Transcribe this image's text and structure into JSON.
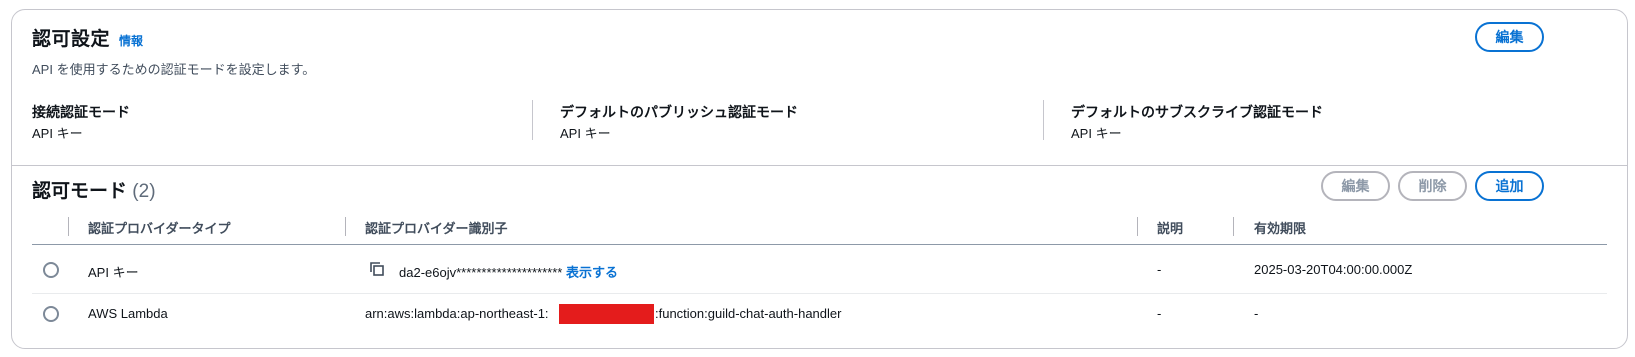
{
  "auth_settings": {
    "title": "認可設定",
    "info_link": "情報",
    "description": "API を使用するための認証モードを設定します。",
    "edit_button": "編集",
    "fields": [
      {
        "label": "接続認証モード",
        "value": "API キー"
      },
      {
        "label": "デフォルトのパブリッシュ認証モード",
        "value": "API キー"
      },
      {
        "label": "デフォルトのサブスクライブ認証モード",
        "value": "API キー"
      }
    ]
  },
  "auth_modes": {
    "title": "認可モード",
    "count": "(2)",
    "buttons": {
      "edit": "編集",
      "delete": "削除",
      "add": "追加"
    },
    "columns": [
      "認証プロバイダータイプ",
      "認証プロバイダー識別子",
      "説明",
      "有効期限"
    ],
    "rows": [
      {
        "type": "API キー",
        "identifier": "da2-e6ojv*********************",
        "show_link": "表示する",
        "description": "-",
        "expiry": "2025-03-20T04:00:00.000Z"
      },
      {
        "type": "AWS Lambda",
        "identifier_prefix": "arn:aws:lambda:ap-northeast-1:",
        "identifier_suffix": ":function:guild-chat-auth-handler",
        "description": "-",
        "expiry": "-"
      }
    ]
  },
  "colors": {
    "accent": "#0972d3",
    "redaction": "#e41c1c"
  },
  "icons": {
    "copy": "copy-icon"
  }
}
